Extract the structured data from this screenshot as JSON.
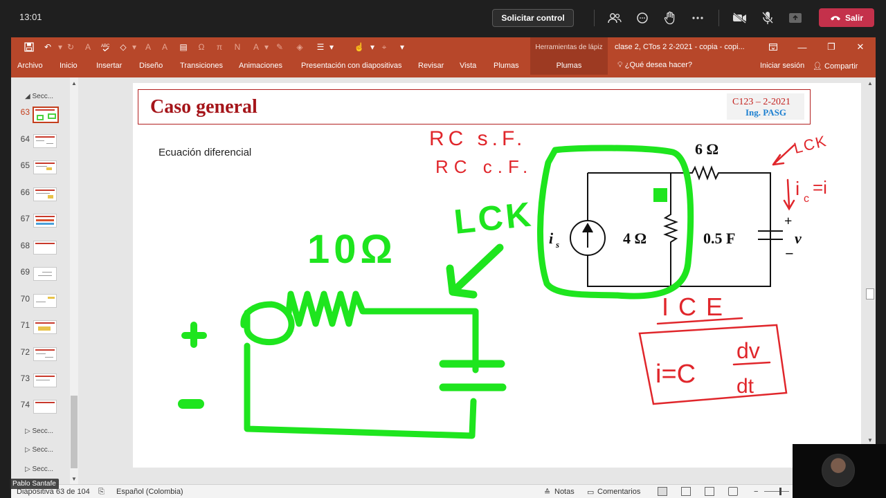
{
  "teams": {
    "clock": "13:01",
    "request_control": "Solicitar control",
    "leave": "Salir",
    "participant_name": "Pablo Santafe"
  },
  "ppt": {
    "context_tool_title": "Herramientas de lápiz",
    "window_title": "clase 2, CTos  2  2-2021  - copia - copi...",
    "tabs": [
      "Archivo",
      "Inicio",
      "Insertar",
      "Diseño",
      "Transiciones",
      "Animaciones",
      "Presentación con diapositivas",
      "Revisar",
      "Vista",
      "Plumas"
    ],
    "context_tab": "Plumas",
    "tell_me": "¿Qué desea hacer?",
    "sign_in": "Iniciar sesión",
    "share": "Compartir",
    "section_label": "Secc...",
    "slide_numbers": [
      "63",
      "64",
      "65",
      "66",
      "67",
      "68",
      "69",
      "70",
      "71",
      "72",
      "73",
      "74"
    ],
    "selected_slide": "63",
    "status": {
      "slide_info": "Diapositiva 63 de 104",
      "language": "Español (Colombia)",
      "notes": "Notas",
      "comments": "Comentarios"
    }
  },
  "slide": {
    "title": "Caso general",
    "course": "C123 – 2-2021",
    "author": "Ing. PASG",
    "subtitle": "Ecuación diferencial",
    "circuit": {
      "source": "i",
      "source_sub": "s",
      "r1": "4 Ω",
      "r2": "6 Ω",
      "cap": "0.5 F",
      "volt": "v",
      "plus": "+",
      "minus": "−"
    },
    "annotations": {
      "rc_sf": "RC  s.F.",
      "rc_cf": "RC  c.F.",
      "lck_top": "LCK",
      "lck_big": "LCK",
      "ic_eq": "i",
      "ic_sub": "c",
      "ic_rhs": "=i",
      "ice": "ICE",
      "formula_lhs": "i=C",
      "formula_num": "dv",
      "formula_den": "dt",
      "res_label": "10Ω",
      "plus": "+",
      "minus": "-"
    }
  },
  "colors": {
    "ppt_brand": "#b7472a",
    "title_red": "#a5151a",
    "ink_green": "#1ee51e",
    "ink_red": "#e0262b",
    "teams_leave": "#c4314b"
  }
}
